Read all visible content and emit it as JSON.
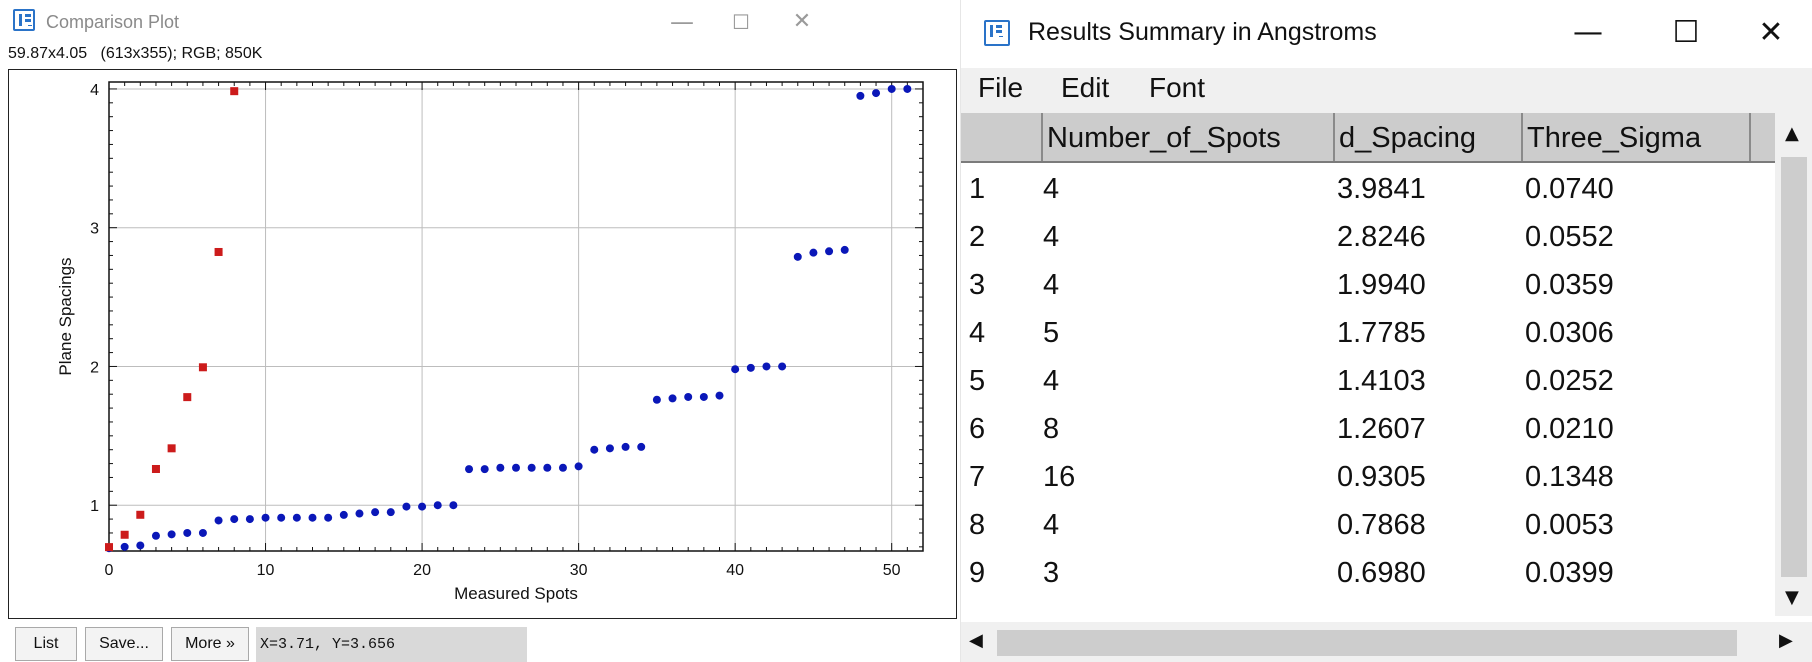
{
  "plot_window": {
    "title": "Comparison Plot",
    "info": "59.87x4.05   (613x355); RGB; 850K",
    "controls": {
      "minimize": "—",
      "maximize": "☐",
      "close": "✕"
    },
    "buttons": {
      "list": "List",
      "save": "Save...",
      "more": "More »"
    },
    "coords": "X=3.71, Y=3.656"
  },
  "chart_data": {
    "type": "scatter",
    "xlabel": "Measured Spots",
    "ylabel": "Plane Spacings",
    "xlim": [
      0,
      52
    ],
    "ylim": [
      0.67,
      4.05
    ],
    "xticks": [
      0,
      10,
      20,
      30,
      40,
      50
    ],
    "yticks": [
      1,
      2,
      3,
      4
    ],
    "grid": true,
    "series": [
      {
        "color": "#cc1b1b",
        "marker": "square",
        "x": [
          0,
          1,
          2,
          3,
          4,
          5,
          6,
          7,
          8
        ],
        "y": [
          0.698,
          0.787,
          0.931,
          1.261,
          1.41,
          1.779,
          1.994,
          2.825,
          3.984
        ]
      },
      {
        "color": "#0a17b8",
        "marker": "circle",
        "x": [
          0,
          1,
          2,
          3,
          4,
          5,
          6,
          7,
          8,
          9,
          10,
          11,
          12,
          13,
          14,
          15,
          16,
          17,
          18,
          19,
          20,
          21,
          22,
          23,
          24,
          25,
          26,
          27,
          28,
          29,
          30,
          31,
          32,
          33,
          34,
          35,
          36,
          37,
          38,
          39,
          40,
          41,
          42,
          43,
          44,
          45,
          46,
          47,
          48,
          49,
          50,
          51
        ],
        "y": [
          0.69,
          0.7,
          0.71,
          0.78,
          0.79,
          0.8,
          0.8,
          0.89,
          0.9,
          0.9,
          0.91,
          0.91,
          0.91,
          0.91,
          0.91,
          0.93,
          0.94,
          0.95,
          0.95,
          0.99,
          0.99,
          1.0,
          1.0,
          1.26,
          1.26,
          1.27,
          1.27,
          1.27,
          1.27,
          1.27,
          1.28,
          1.4,
          1.41,
          1.42,
          1.42,
          1.76,
          1.77,
          1.78,
          1.78,
          1.79,
          1.98,
          1.99,
          2.0,
          2.0,
          2.79,
          2.82,
          2.83,
          2.84,
          3.95,
          3.97,
          4.0,
          4.0
        ]
      }
    ]
  },
  "results_window": {
    "title": "Results Summary in Angstroms",
    "controls": {
      "minimize": "—",
      "maximize": "☐",
      "close": "✕"
    },
    "menu": [
      "File",
      "Edit",
      "Font"
    ],
    "columns": [
      "",
      "Number_of_Spots",
      "d_Spacing",
      "Three_Sigma"
    ],
    "rows": [
      [
        "1",
        "4",
        "3.9841",
        "0.0740"
      ],
      [
        "2",
        "4",
        "2.8246",
        "0.0552"
      ],
      [
        "3",
        "4",
        "1.9940",
        "0.0359"
      ],
      [
        "4",
        "5",
        "1.7785",
        "0.0306"
      ],
      [
        "5",
        "4",
        "1.4103",
        "0.0252"
      ],
      [
        "6",
        "8",
        "1.2607",
        "0.0210"
      ],
      [
        "7",
        "16",
        "0.9305",
        "0.1348"
      ],
      [
        "8",
        "4",
        "0.7868",
        "0.0053"
      ],
      [
        "9",
        "3",
        "0.6980",
        "0.0399"
      ]
    ],
    "scroll_icons": {
      "up": "▲",
      "down": "▼",
      "left": "◀",
      "right": "▶"
    }
  }
}
